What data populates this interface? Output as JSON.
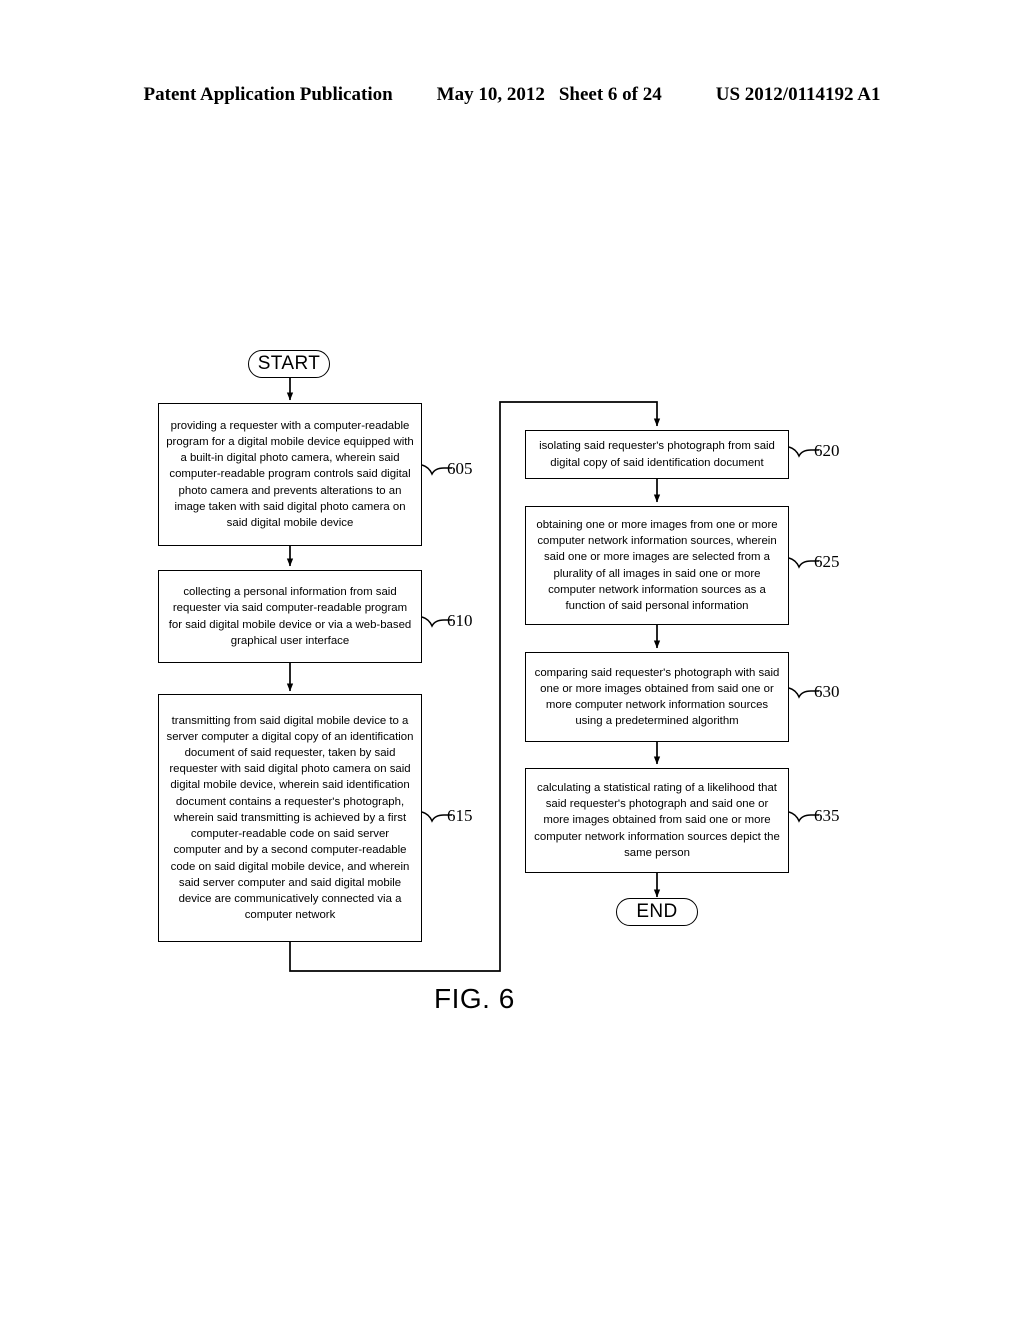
{
  "header": {
    "publication": "Patent Application Publication",
    "date": "May 10, 2012",
    "sheet": "Sheet 6 of 24",
    "patent_number": "US 2012/0114192 A1"
  },
  "figure": {
    "caption": "FIG. 6",
    "start_label": "START",
    "end_label": "END"
  },
  "nodes": [
    {
      "ref": "605",
      "text": "providing a requester with a computer-readable program for a digital mobile device equipped with a built-in digital photo camera, wherein said computer-readable program controls said digital photo camera and prevents alterations to an image taken with said digital photo camera on said digital mobile device"
    },
    {
      "ref": "610",
      "text": "collecting a personal information from said requester via said computer-readable program for said digital mobile device or via a web-based graphical user interface"
    },
    {
      "ref": "615",
      "text": "transmitting from said digital mobile device to a server computer a digital copy of an identification document of said requester, taken by said requester with said digital photo camera on said digital mobile device, wherein said identification document contains a requester's photograph, wherein said transmitting is achieved by a first computer-readable code on said server computer and by a second computer-readable code on said digital mobile device, and wherein said server computer and said digital mobile device are communicatively connected via a computer network"
    },
    {
      "ref": "620",
      "text": "isolating said requester's photograph from said digital copy of said identification document"
    },
    {
      "ref": "625",
      "text": "obtaining one or more images from one or more computer network information sources, wherein said one or more images are selected from a plurality of all images in said one or more computer network information sources as a function of said personal information"
    },
    {
      "ref": "630",
      "text": "comparing said requester's photograph with said one or more images obtained from said one or more computer network information sources using a predetermined algorithm"
    },
    {
      "ref": "635",
      "text": "calculating a statistical rating of a likelihood that said requester's photograph and said one or more images obtained from said one or more computer network information sources depict the same person"
    }
  ],
  "colors": {
    "ink": "#000000",
    "paper": "#ffffff"
  }
}
